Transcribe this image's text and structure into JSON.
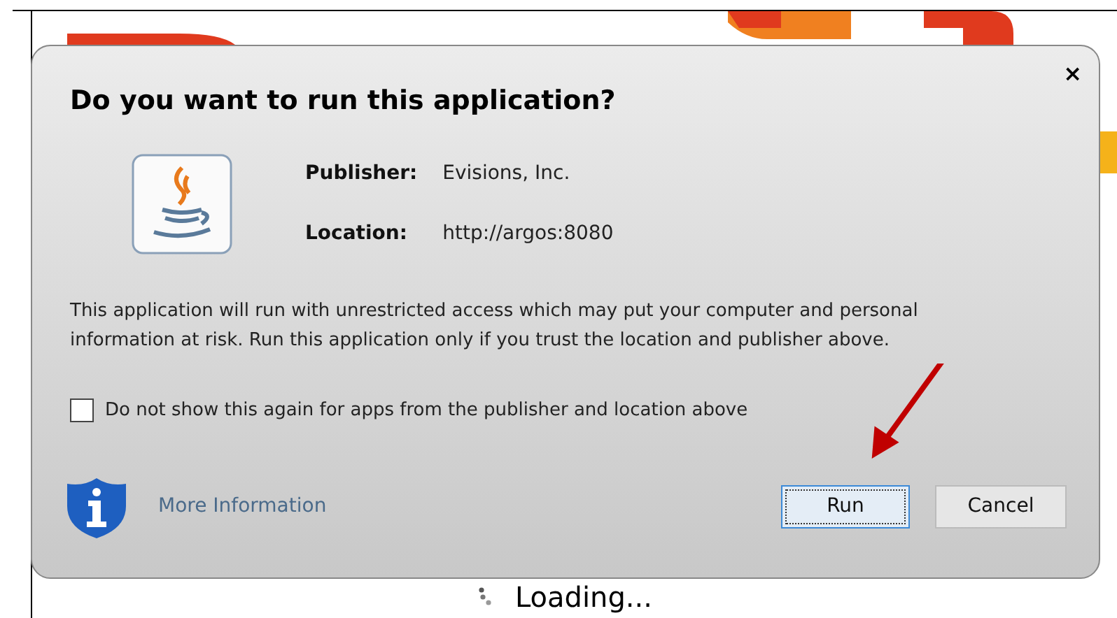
{
  "dialog": {
    "close": "×",
    "title": "Do you want to run this application?",
    "details": [
      {
        "label": "Publisher:",
        "value": "Evisions, Inc."
      },
      {
        "label": "Location:",
        "value": "http://argos:8080"
      }
    ],
    "warning": "This application will run with unrestricted access which may put your computer and personal information at risk. Run this application only if you trust the location and publisher above.",
    "checkbox": {
      "label": "Do not show this again for apps from the publisher and location above",
      "checked": false
    },
    "more_info_link": "More Information",
    "buttons": [
      {
        "label": "Run",
        "focused": true
      },
      {
        "label": "Cancel",
        "focused": false
      }
    ]
  },
  "loading": "Loading..."
}
